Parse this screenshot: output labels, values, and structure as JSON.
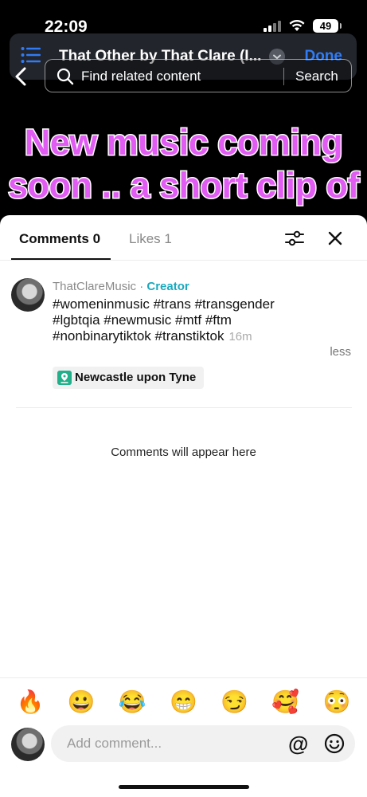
{
  "status_bar": {
    "time": "22:09",
    "battery": "49",
    "icons": [
      "signal-icon",
      "wifi-icon",
      "battery-icon"
    ]
  },
  "now_playing": {
    "title": "That Other by That Clare (I...",
    "done_label": "Done",
    "icons": [
      "list-icon",
      "chevron-down-icon"
    ]
  },
  "search": {
    "placeholder": "Find related content",
    "button_label": "Search"
  },
  "video_overlay": {
    "line1": "New music coming",
    "line2": "soon .. a short clip of",
    "text_color": "#e15cf2"
  },
  "comments_panel": {
    "tabs": [
      {
        "label": "Comments 0",
        "active": true
      },
      {
        "label": "Likes 1",
        "active": false
      }
    ],
    "post": {
      "author": "ThatClareMusic",
      "separator": " · ",
      "badge": "Creator",
      "caption": "#womeninmusic #trans #transgender #lgbtqia #newmusic #mtf #ftm #nonbinarytiktok #transtiktok",
      "time": "16m",
      "less_label": "less",
      "location": "Newcastle upon Tyne"
    },
    "empty_message": "Comments will appear here",
    "emojis": [
      "🔥",
      "😀",
      "😂",
      "😁",
      "😏",
      "🥰",
      "😳"
    ],
    "composer": {
      "placeholder": "Add comment...",
      "at_symbol": "@"
    }
  },
  "colors": {
    "accent_blue": "#2f7cf6",
    "creator_teal": "#1ba9bf",
    "location_green": "#21b08a"
  }
}
